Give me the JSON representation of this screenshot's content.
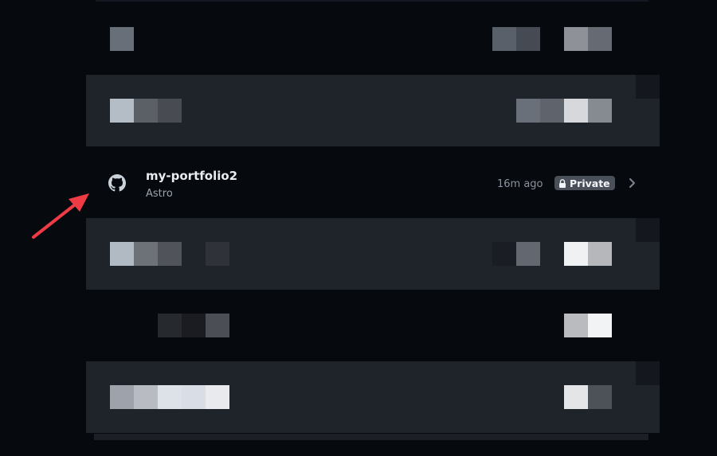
{
  "highlighted_repo": {
    "name": "my-portfolio2",
    "framework": "Astro",
    "updated": "16m ago",
    "visibility": "Private"
  },
  "icons": {
    "repo": "github-icon",
    "lock": "lock-icon",
    "chevron": "chevron-right-icon",
    "annotation": "red-arrow-annotation"
  },
  "colors": {
    "background": "#06090d",
    "row_alt": "#1f232a",
    "arrow": "#ef3b45",
    "badge": "#4a5059"
  }
}
